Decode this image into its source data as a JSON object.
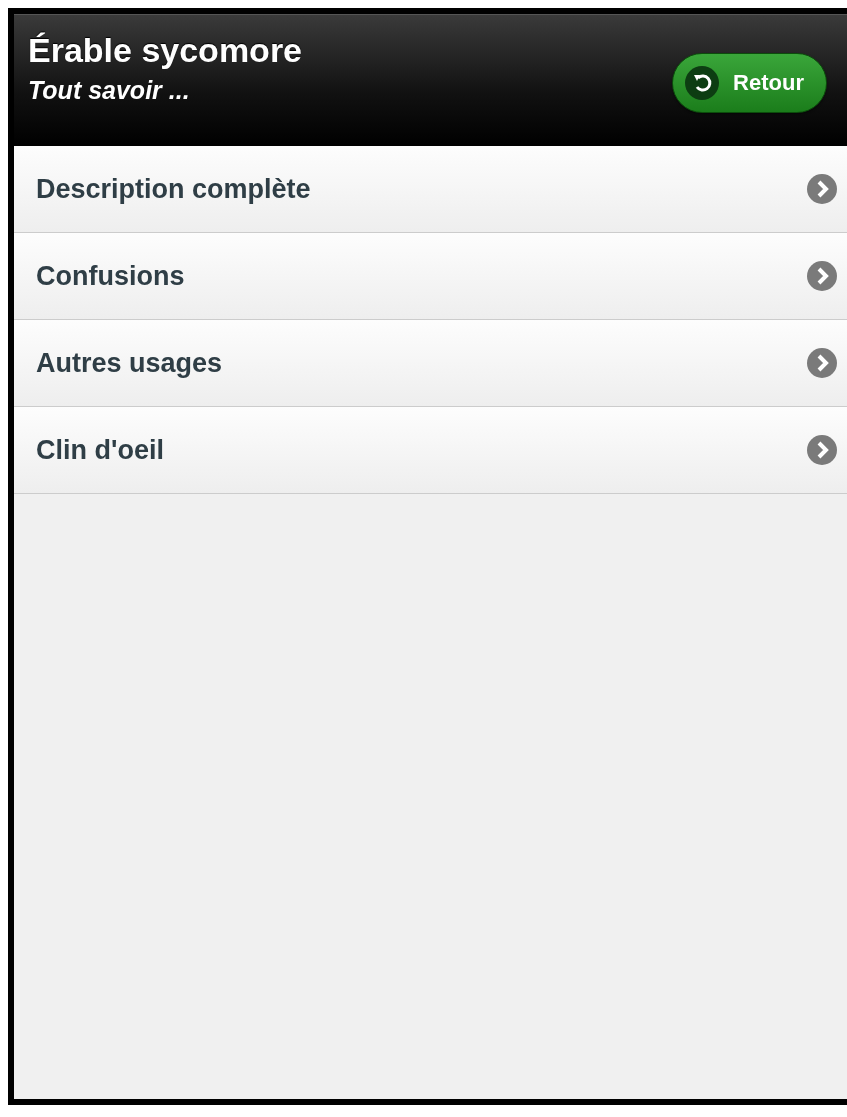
{
  "header": {
    "title": "Érable sycomore",
    "subtitle": "Tout savoir ...",
    "back_button": {
      "label": "Retour"
    }
  },
  "menu": [
    {
      "label": "Description complète"
    },
    {
      "label": "Confusions"
    },
    {
      "label": "Autres usages"
    },
    {
      "label": "Clin d'oeil"
    }
  ]
}
